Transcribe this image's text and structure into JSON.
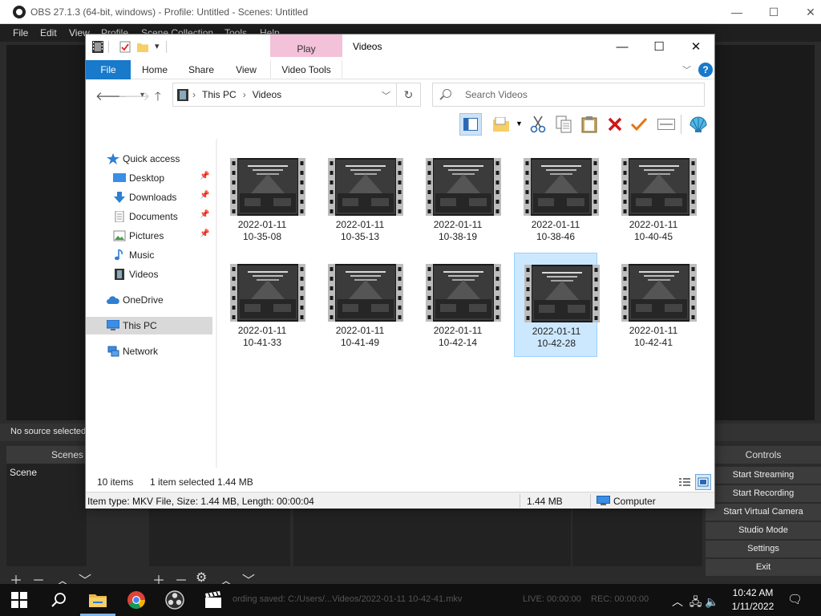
{
  "obs": {
    "title": "OBS 27.1.3 (64-bit, windows) - Profile: Untitled - Scenes: Untitled",
    "menu": [
      "File",
      "Edit",
      "View",
      "Profile",
      "Scene Collection",
      "Tools",
      "Help"
    ],
    "source_status": "No source selected",
    "scenes_header": "Scenes",
    "scene_item": "Scene",
    "controls_header": "Controls",
    "controls": [
      "Start Streaming",
      "Start Recording",
      "Start Virtual Camera",
      "Studio Mode",
      "Settings",
      "Exit"
    ],
    "live": "LIVE: 00:00:00",
    "rec": "REC: 00:00:00"
  },
  "explorer": {
    "title": "Videos",
    "context_tab_top": "Play",
    "ribbon_tabs": [
      "File",
      "Home",
      "Share",
      "View",
      "Video Tools"
    ],
    "address": {
      "root": "This PC",
      "folder": "Videos"
    },
    "search_placeholder": "Search Videos",
    "nav": {
      "quick_access": "Quick access",
      "items": [
        "Desktop",
        "Downloads",
        "Documents",
        "Pictures",
        "Music",
        "Videos"
      ],
      "onedrive": "OneDrive",
      "this_pc": "This PC",
      "network": "Network"
    },
    "files": [
      {
        "date": "2022-01-11",
        "time": "10-35-08"
      },
      {
        "date": "2022-01-11",
        "time": "10-35-13"
      },
      {
        "date": "2022-01-11",
        "time": "10-38-19"
      },
      {
        "date": "2022-01-11",
        "time": "10-38-46"
      },
      {
        "date": "2022-01-11",
        "time": "10-40-45"
      },
      {
        "date": "2022-01-11",
        "time": "10-41-33"
      },
      {
        "date": "2022-01-11",
        "time": "10-41-49"
      },
      {
        "date": "2022-01-11",
        "time": "10-42-14"
      },
      {
        "date": "2022-01-11",
        "time": "10-42-28"
      },
      {
        "date": "2022-01-11",
        "time": "10-42-41"
      }
    ],
    "selected_index": 8,
    "status": {
      "count": "10 items",
      "selection": "1 item selected  1.44 MB"
    },
    "info": {
      "type": "Item type: MKV File, Size: 1.44 MB, Length: 00:00:04",
      "size": "1.44 MB",
      "location": "Computer"
    }
  },
  "taskbar": {
    "time": "10:42 AM",
    "date": "1/11/2022",
    "ghost_text": "ording saved: C:/Users/...Videos/2022-01-11 10-42-41.mkv"
  },
  "colors": {
    "accent": "#1979ca",
    "selection": "#cce8ff",
    "context_tab": "#f3c1d9"
  }
}
